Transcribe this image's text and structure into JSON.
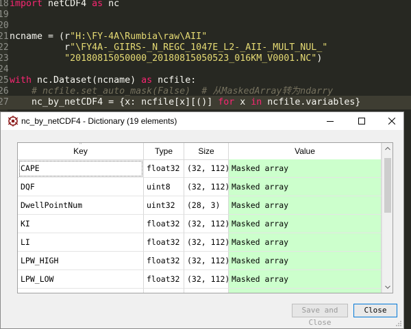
{
  "editor": {
    "lines": [
      {
        "num": "18",
        "segments": [
          {
            "t": "import",
            "c": "kw"
          },
          {
            "t": " netCDF4 ",
            "c": ""
          },
          {
            "t": "as",
            "c": "kw"
          },
          {
            "t": " nc",
            "c": ""
          }
        ]
      },
      {
        "num": "19",
        "segments": []
      },
      {
        "num": "20",
        "segments": []
      },
      {
        "num": "21",
        "segments": [
          {
            "t": "ncname = (r",
            "c": ""
          },
          {
            "t": "\"H:\\FY-4A\\Rumbia\\raw\\AII\"",
            "c": "str"
          }
        ]
      },
      {
        "num": "22",
        "segments": [
          {
            "t": "          r",
            "c": ""
          },
          {
            "t": "\"\\FY4A-_GIIRS-_N_REGC_1047E_L2-_AII-_MULT_NUL_\"",
            "c": "str"
          }
        ]
      },
      {
        "num": "23",
        "segments": [
          {
            "t": "          ",
            "c": ""
          },
          {
            "t": "\"20180815050000_20180815050523_016KM_V0001.NC\"",
            "c": "str"
          },
          {
            "t": ")",
            "c": ""
          }
        ]
      },
      {
        "num": "24",
        "segments": []
      },
      {
        "num": "25",
        "segments": [
          {
            "t": "with",
            "c": "kw"
          },
          {
            "t": " nc.Dataset(ncname) ",
            "c": ""
          },
          {
            "t": "as",
            "c": "kw"
          },
          {
            "t": " ncfile:",
            "c": ""
          }
        ]
      },
      {
        "num": "26",
        "segments": [
          {
            "t": "    ",
            "c": ""
          },
          {
            "t": "# ncfile.set_auto_mask(False)  # 从MaskedArray转为ndarry",
            "c": "cmt"
          }
        ]
      },
      {
        "num": "27",
        "segments": [
          {
            "t": "    nc_by_netCDF4 = {x: ncfile[x][()] ",
            "c": ""
          },
          {
            "t": "for",
            "c": "kw"
          },
          {
            "t": " x ",
            "c": ""
          },
          {
            "t": "in",
            "c": "kw"
          },
          {
            "t": " ncfile.variables}",
            "c": ""
          }
        ]
      }
    ]
  },
  "dialog": {
    "title": "nc_by_netCDF4 - Dictionary (19 elements)",
    "columns": [
      "Key",
      "Type",
      "Size",
      "Value"
    ],
    "rows": [
      [
        "CAPE",
        "float32",
        "(32, 112)",
        "Masked array"
      ],
      [
        "DQF",
        "uint8",
        "(32, 112)",
        "Masked array"
      ],
      [
        "DwellPointNum",
        "uint32",
        "(28, 3)",
        "Masked array"
      ],
      [
        "KI",
        "float32",
        "(32, 112)",
        "Masked array"
      ],
      [
        "LI",
        "float32",
        "(32, 112)",
        "Masked array"
      ],
      [
        "LPW_HIGH",
        "float32",
        "(32, 112)",
        "Masked array"
      ],
      [
        "LPW_LOW",
        "float32",
        "(32, 112)",
        "Masked array"
      ],
      [
        "",
        "",
        "",
        ""
      ]
    ],
    "buttons": {
      "save_close": "Save and Close",
      "close": "Close"
    }
  },
  "colors": {
    "value_bg": "#ccffcc",
    "editor_bg": "#272822",
    "keyword": "#f92672",
    "string": "#e6db74",
    "comment": "#75715e"
  }
}
